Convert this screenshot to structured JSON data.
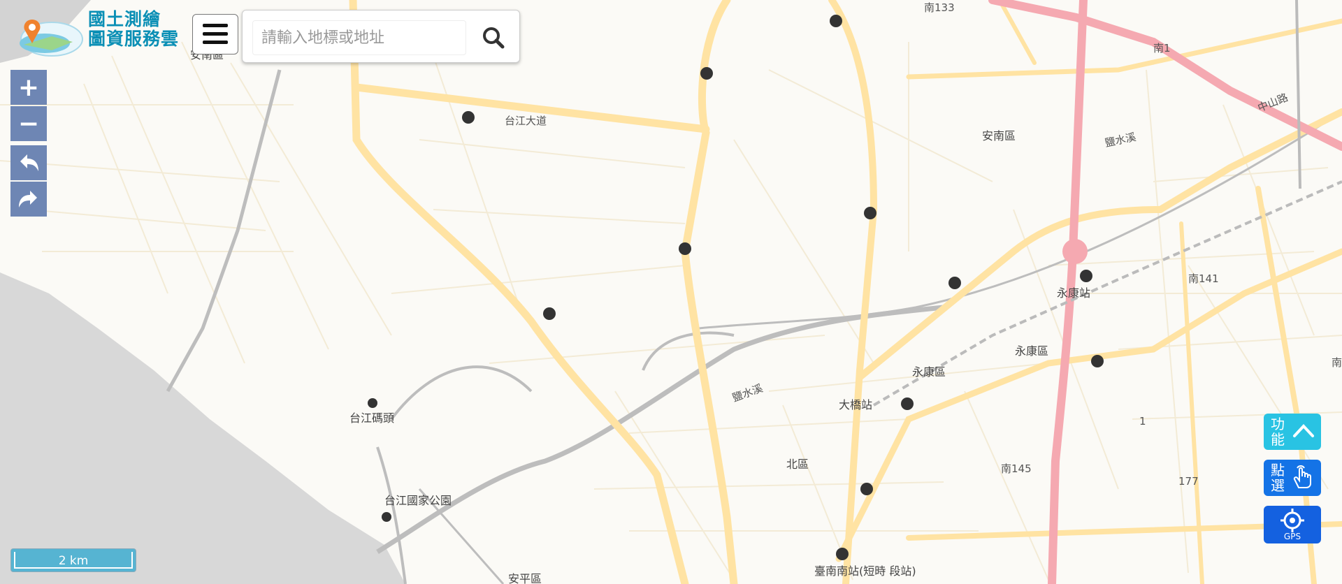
{
  "app": {
    "logo_line1": "國土測繪",
    "logo_line2": "圖資服務雲"
  },
  "search": {
    "placeholder": "請輸入地標或地址"
  },
  "icons": {
    "menu": "hamburger-menu-icon",
    "search": "search-icon",
    "undo": "undo-arrow-icon",
    "redo": "redo-arrow-icon",
    "function": "chevron-up-icon",
    "select": "hand-pointer-icon",
    "gps": "gps-crosshair-icon"
  },
  "controls": {
    "zoom_in": "+",
    "zoom_out": "−"
  },
  "right_panel": {
    "function_label": "功能",
    "select_label": "點選",
    "gps_label": "GPS"
  },
  "scale_bar": {
    "label": "2 km"
  },
  "map_labels": {
    "anan_district_top": "安南區",
    "taijiang_blvd": "台江大道",
    "anan_district": "安南區",
    "yanshui_river_ne": "鹽水溪",
    "zhongshan_road": "中山路",
    "south_133": "南133",
    "south_141": "南141",
    "yongkang_station": "永康站",
    "yongkang_district": "永康區",
    "yongkang_district_2": "永康區",
    "yanshui_river": "鹽水溪",
    "daqiao_station": "大橋站",
    "north_district": "北區",
    "south_145": "南145",
    "taijiang_pier": "台江碼頭",
    "taijiang_park": "台江國家公園",
    "anping_district": "安平區",
    "tainan_south_station": "臺南南站(短時 段站)",
    "route_1": "1",
    "route_177": "177",
    "south_road": "南",
    "route_s1": "南1"
  },
  "colors": {
    "road_major": "#ffe6a8",
    "road_minor": "#f5ecd2",
    "freeway": "#f6a5ae",
    "water": "#b9b9b9",
    "sea": "#d9d9d9",
    "control_bg": "#6e86b4",
    "scale_bg": "#56b4d2",
    "function_btn": "#29c3e3",
    "select_btn": "#1473e6",
    "gps_btn": "#1461e0",
    "logo_text": "#0a8fb5"
  }
}
